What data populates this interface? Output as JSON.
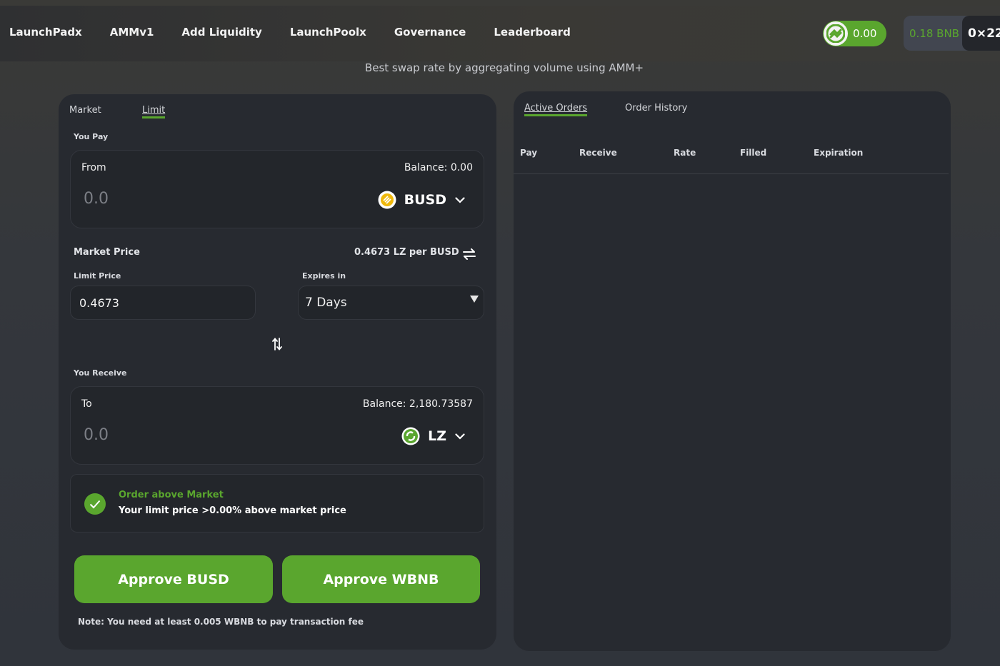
{
  "nav": {
    "items": [
      "LaunchPadx",
      "AMMv1",
      "Add Liquidity",
      "LaunchPoolx",
      "Governance",
      "Leaderboard"
    ]
  },
  "header": {
    "lz_balance": "0.00",
    "bnb_balance": "0.18 BNB",
    "address": "0×22"
  },
  "subtitle": "Best swap rate by aggregating volume using AMM+",
  "swap": {
    "tabs": {
      "market": "Market",
      "limit": "Limit"
    },
    "pay": {
      "section_label": "You Pay",
      "from_label": "From",
      "balance": "Balance: 0.00",
      "amount_placeholder": "0.0",
      "token": "BUSD"
    },
    "market_price": {
      "label": "Market Price",
      "value": "0.4673 LZ per BUSD"
    },
    "limit_price": {
      "label": "Limit Price",
      "value": "0.4673"
    },
    "expires": {
      "label": "Expires in",
      "value": "7 Days"
    },
    "receive": {
      "section_label": "You Receive",
      "to_label": "To",
      "balance": "Balance: 2,180.73587",
      "amount_placeholder": "0.0",
      "token": "LZ"
    },
    "notice": {
      "title": "Order above Market",
      "text": "Your limit price >0.00% above market price"
    },
    "buttons": {
      "approve_busd": "Approve BUSD",
      "approve_wbnb": "Approve WBNB"
    },
    "note": "Note: You need at least 0.005 WBNB to pay transaction fee"
  },
  "orders": {
    "tabs": {
      "active": "Active Orders",
      "history": "Order History"
    },
    "columns": {
      "pay": "Pay",
      "receive": "Receive",
      "rate": "Rate",
      "filled": "Filled",
      "expiration": "Expiration"
    }
  },
  "colors": {
    "accent": "#5aa62e",
    "card": "#272a30",
    "busd": "#f0b90b"
  }
}
